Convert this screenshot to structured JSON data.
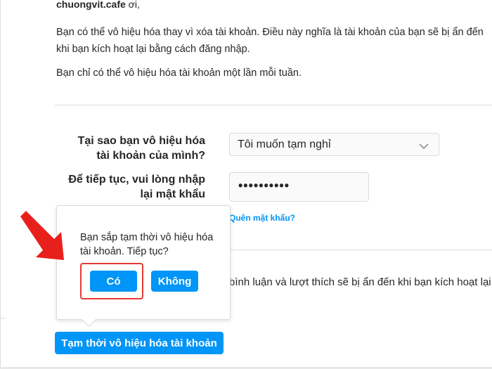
{
  "intro": {
    "greeting_name": "chuongvit.cafe",
    "greeting_suffix": " ơi,",
    "paragraph1_line1": "Bạn có thể vô hiệu hóa thay vì xóa tài khoản. Điều này nghĩa là tài khoản của bạn sẽ bị ẩn đến",
    "paragraph1_line2": "khi bạn kích hoạt lại bằng cách đăng nhập.",
    "paragraph2": "Bạn chỉ có thể vô hiệu hóa tài khoản một lần mỗi tuần."
  },
  "form": {
    "reason_label_line1": "Tại sao bạn vô hiệu hóa",
    "reason_label_line2": "tài khoản của mình?",
    "reason_value": "Tôi muốn tạm nghỉ",
    "password_label_line1": "Để tiếp tục, vui lòng nhập",
    "password_label_line2": "lại mật khẩu",
    "password_value": "••••••••••",
    "forgot_link": "Quên mật khẩu?",
    "hidden_text": "bình luận và lượt thích sẽ bị ẩn đến khi bạn kích hoạt lại"
  },
  "popover": {
    "message": "Bạn sắp tạm thời vô hiệu hóa tài khoản. Tiếp tục?",
    "yes_label": "Có",
    "no_label": "Không"
  },
  "submit_label": "Tạm thời vô hiệu hóa tài khoản",
  "icons": {
    "select_chevron": "chevron-down-icon",
    "annotation_arrow": "red-arrow-icon"
  },
  "colors": {
    "primary_blue": "#0095f6",
    "annotation_red": "#e53935",
    "border": "#dbdbdb"
  }
}
